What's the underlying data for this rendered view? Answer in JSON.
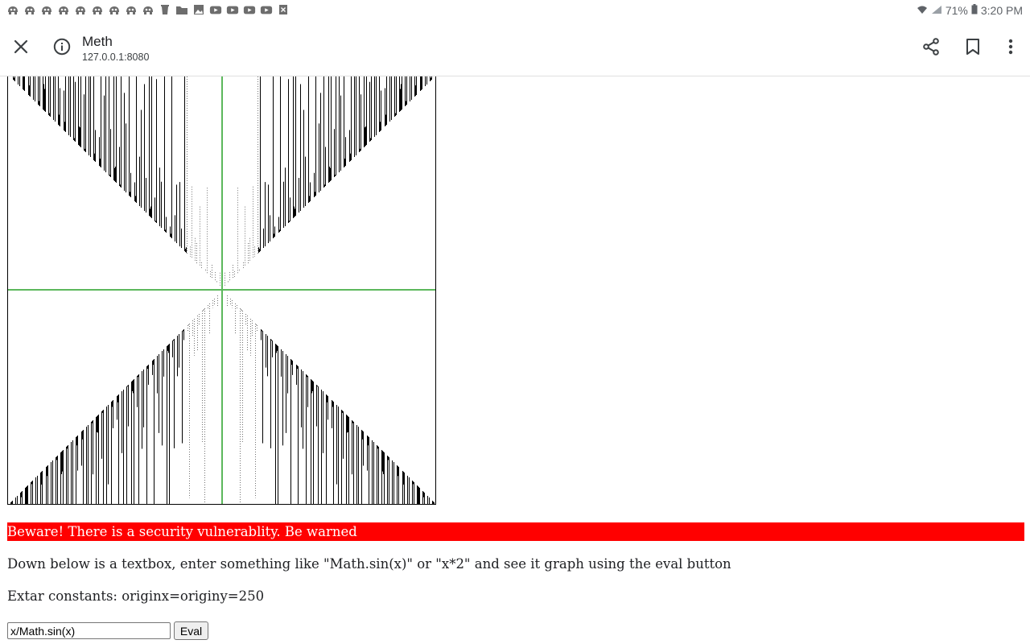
{
  "status_bar": {
    "notification_icons": [
      "app-icon",
      "app-icon",
      "app-icon",
      "app-icon",
      "app-icon",
      "app-icon",
      "app-icon",
      "app-icon",
      "app-icon",
      "cup-icon",
      "folder-icon",
      "image-icon",
      "youtube-icon",
      "youtube-icon",
      "youtube-icon",
      "youtube-icon",
      "close-box-icon"
    ],
    "battery": "71%",
    "time": "3:20 PM"
  },
  "browser": {
    "page_title": "Meth",
    "url": "127.0.0.1:8080",
    "icons": {
      "close": "close-icon",
      "info": "info-icon",
      "share": "share-icon",
      "bookmark": "bookmark-icon",
      "menu": "more-vert-icon"
    }
  },
  "graph": {
    "expression": "x/Math.sin(x)",
    "axis_color": "#5cb85c"
  },
  "content": {
    "warning": "Beware! There is a security vulnerablity. Be warned",
    "instructions": "Down below is a textbox, enter something like \"Math.sin(x)\" or \"x*2\" and see it graph using the eval button",
    "constants": "Extar constants: originx=originy=250",
    "input_value": "x/Math.sin(x)",
    "eval_label": "Eval"
  },
  "colors": {
    "warning_bg": "#ff0000",
    "warning_text": "#ffffff"
  }
}
